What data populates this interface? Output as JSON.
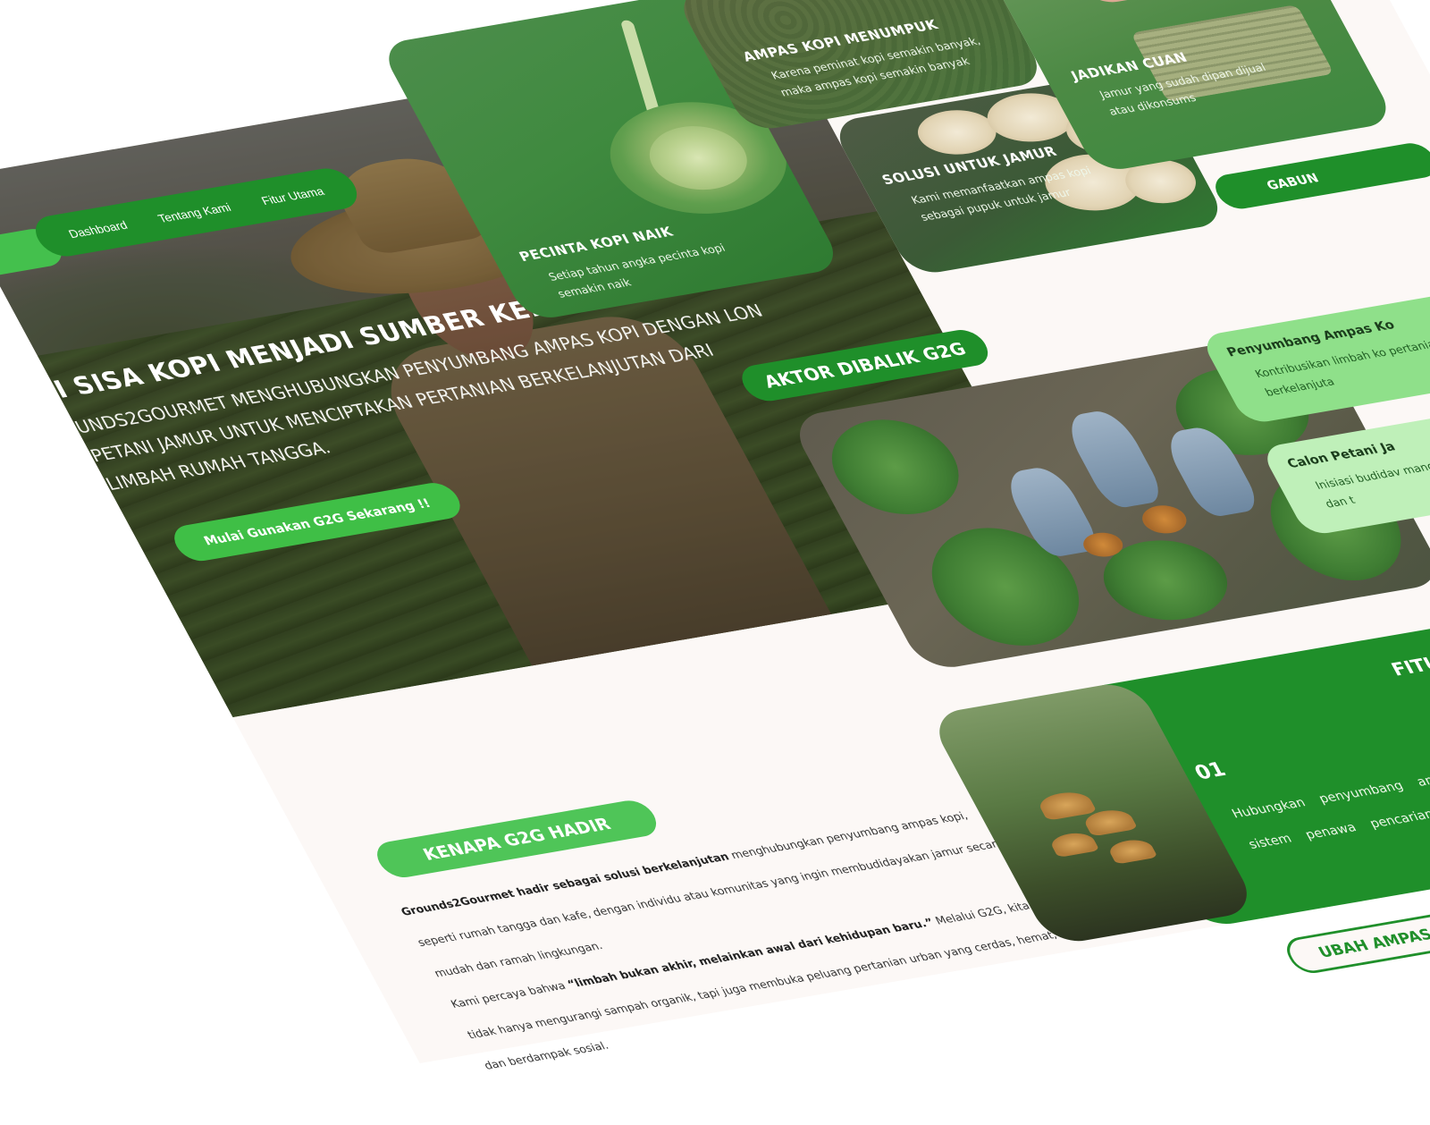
{
  "nav": {
    "items": [
      "Dashboard",
      "Tentang Kami",
      "Fitur Utama"
    ]
  },
  "hero": {
    "title": "I SISA KOPI MENJADI SUMBER KEHIDUPAN BARU .",
    "subtitle": "UNDS2GOURMET MENGHUBUNGKAN PENYUMBANG AMPAS KOPI DENGAN LON PETANI JAMUR UNTUK MENCIPTAKAN PERTANIAN BERKELANJUTAN DARI LIMBAH RUMAH TANGGA.",
    "cta": "Mulai Gunakan G2G Sekarang !!"
  },
  "cards": {
    "kopi": {
      "title": "PECINTA KOPI NAIK",
      "desc": "Setiap tahun angka pecinta kopi semakin naik"
    },
    "ampas": {
      "title": "AMPAS KOPI MENUMPUK",
      "desc": "Karena peminat kopi semakin banyak, maka ampas kopi semakin banyak"
    },
    "jamur": {
      "title": "SOLUSI UNTUK JAMUR",
      "desc": "Kami memanfaatkan ampas kopi sebagai pupuk untuk jamur"
    },
    "cuan": {
      "title": "JADIKAN CUAN",
      "desc": "Jamur yang sudah dipan dijual atau dikonsums"
    }
  },
  "join_button": "GABUN",
  "actors": {
    "heading": "AKTOR DIBALIK G2G",
    "roles": [
      {
        "title": "Penyumbang Ampas Ko",
        "desc": "Kontribusikan limbah ko pertanian berkelanjuta"
      },
      {
        "title": "Calon Petani Ja",
        "desc": "Inisiasi budidav mandiri dan t"
      }
    ]
  },
  "fitur": {
    "title": "FITUR UTA",
    "number": "01",
    "text": "Hubungkan penyumbang ampas de petani jamur melalui sistem penawa pencarian sederhana."
  },
  "why": {
    "heading": "KENAPA G2G HADIR",
    "p1_bold": "Grounds2Gourmet hadir sebagai solusi berkelanjutan",
    "p1_rest": " menghubungkan penyumbang ampas kopi, seperti rumah tangga dan kafe, dengan individu atau komunitas yang ingin membudidayakan jamur secara mudah dan ramah lingkungan.",
    "p2_start": "Kami percaya bahwa ",
    "p2_bold": "“limbah bukan akhir, melainkan awal dari kehidupan baru.”",
    "p2_rest": " Melalui G2G, kita tidak hanya mengurangi sampah organik, tapi juga membuka peluang pertanian urban yang cerdas, hemat, dan berdampak sosial."
  },
  "bottom": {
    "ubah": "UBAH AMPAS",
    "num": "01"
  }
}
